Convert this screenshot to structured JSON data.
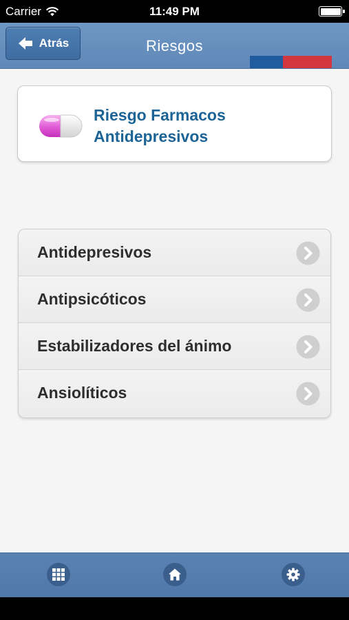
{
  "status_bar": {
    "carrier": "Carrier",
    "time": "11:49 PM"
  },
  "nav": {
    "back_label": "Atrás",
    "title": "Riesgos"
  },
  "header_card": {
    "title_line1": "Riesgo Farmacos",
    "title_line2": "Antidepresivos",
    "icon": "pill-icon"
  },
  "list": {
    "items": [
      {
        "label": "Antidepresivos"
      },
      {
        "label": "Antipsicóticos"
      },
      {
        "label": "Estabilizadores del ánimo"
      },
      {
        "label": "Ansiolíticos"
      }
    ]
  },
  "tabbar": {
    "icons": [
      "grid-icon",
      "home-icon",
      "gear-icon"
    ]
  },
  "colors": {
    "nav": "#6a92c0",
    "accent_text": "#1d6496",
    "flag_blue": "#1f5b9e",
    "flag_red": "#d4363f"
  }
}
